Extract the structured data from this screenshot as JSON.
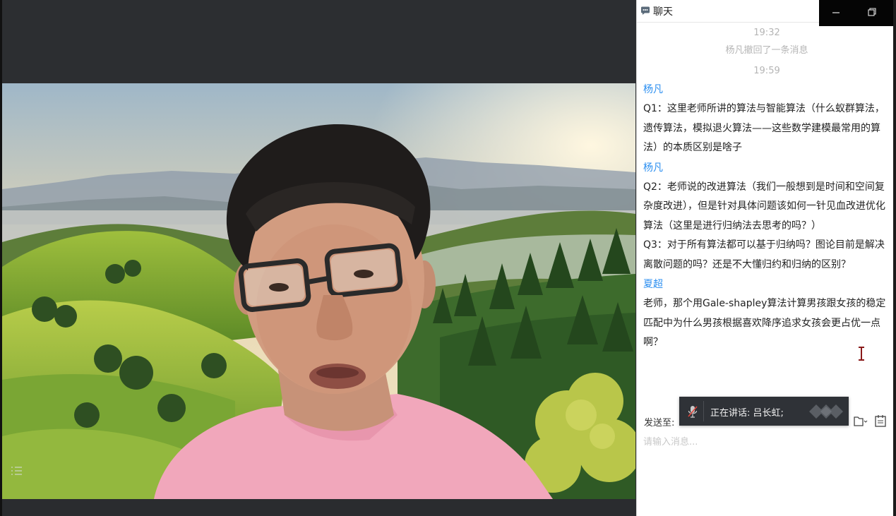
{
  "chat": {
    "title": "聊天",
    "icon": "chat-bubble-icon",
    "messages": [
      {
        "type": "time",
        "text": "19:32"
      },
      {
        "type": "notice",
        "text": "杨凡撤回了一条消息"
      },
      {
        "type": "time",
        "text": "19:59"
      },
      {
        "type": "sender",
        "text": "杨凡"
      },
      {
        "type": "text",
        "text": "Q1：这里老师所讲的算法与智能算法（什么蚁群算法，遗传算法，模拟退火算法——这些数学建模最常用的算法）的本质区别是啥子"
      },
      {
        "type": "sender",
        "text": "杨凡"
      },
      {
        "type": "text",
        "text": "Q2：老师说的改进算法（我们一般想到是时间和空间复杂度改进），但是针对具体问题该如何一针见血改进优化算法（这里是进行归纳法去思考的吗？）"
      },
      {
        "type": "text",
        "text": "Q3：对于所有算法都可以基于归纳吗？图论目前是解决离散问题的吗？还是不大懂归约和归纳的区别？"
      },
      {
        "type": "sender",
        "text": "夏超"
      },
      {
        "type": "text",
        "text": "老师，那个用Gale-shapley算法计算男孩跟女孩的稳定匹配中为什么男孩根据喜欢降序追求女孩会更占优一点啊？"
      }
    ]
  },
  "input": {
    "send_to_label": "发送至:",
    "placeholder": "请输入消息..."
  },
  "speaking": {
    "text": "正在讲话: 吕长虹;"
  },
  "window_controls": {
    "minimize": "minimize-icon",
    "restore": "restore-icon"
  },
  "colors": {
    "sender": "#2a8ef0",
    "toast_bg": "#2f3237",
    "app_bg": "#2c2e31"
  }
}
